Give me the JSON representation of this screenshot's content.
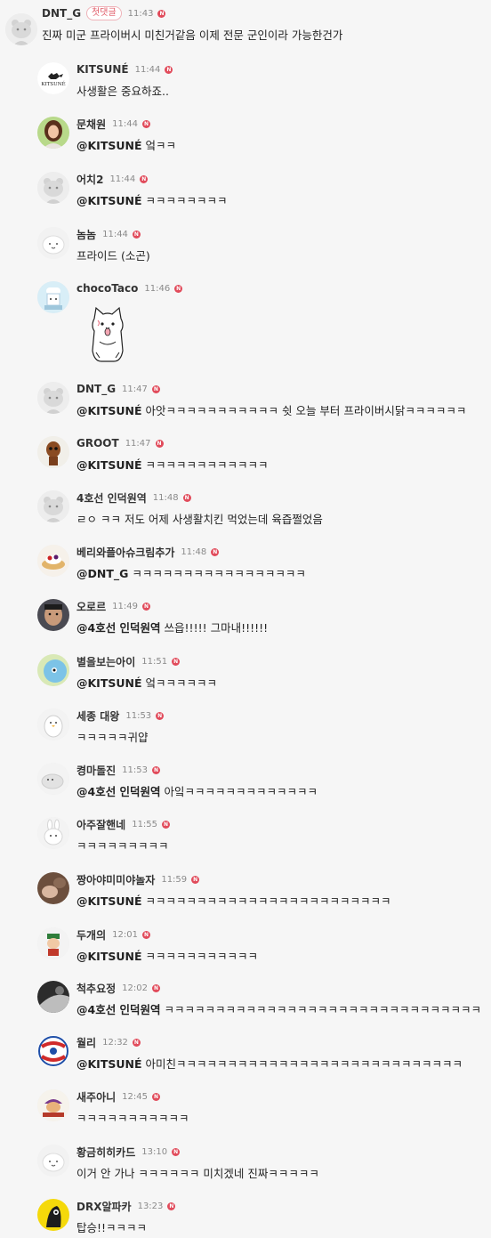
{
  "comments": [
    {
      "author": "DNT_G",
      "badge": "첫댓글",
      "time": "11:43",
      "new_mark": "N",
      "mention": "",
      "text": "진짜 미군 프라이버시 미친거같음 이제 전문 군인이라 가능한건가",
      "avatar_icon": "gray-bear-avatar"
    },
    {
      "author": "KITSUNÉ",
      "time": "11:44",
      "new_mark": "N",
      "mention": "",
      "text": "사생활은 중요하죠..",
      "avatar_icon": "kitsune-fox-logo-avatar",
      "avatar_logo_text": "KITSUNÉ"
    },
    {
      "author": "문채원",
      "time": "11:44",
      "new_mark": "N",
      "mention": "@KITSUNÉ",
      "text": "엌ㅋㅋ",
      "avatar_icon": "woman-photo-avatar"
    },
    {
      "author": "어치2",
      "time": "11:44",
      "new_mark": "N",
      "mention": "@KITSUNÉ",
      "text": "ㅋㅋㅋㅋㅋㅋㅋㅋ",
      "avatar_icon": "gray-bear-avatar"
    },
    {
      "author": "놈놈",
      "time": "11:44",
      "new_mark": "N",
      "mention": "",
      "text": "프라이드 (소곤)",
      "avatar_icon": "white-bunny-avatar"
    },
    {
      "author": "chocoTaco",
      "time": "11:46",
      "new_mark": "N",
      "mention": "",
      "text": "",
      "avatar_icon": "chef-character-avatar",
      "sticker": "cat-sticker"
    },
    {
      "author": "DNT_G",
      "time": "11:47",
      "new_mark": "N",
      "mention": "@KITSUNÉ",
      "text": "아앗ㅋㅋㅋㅋㅋㅋㅋㅋㅋㅋㅋ 쉿 오늘 부터 프라이버시닭ㅋㅋㅋㅋㅋㅋ",
      "avatar_icon": "gray-bear-avatar"
    },
    {
      "author": "GROOT",
      "time": "11:47",
      "new_mark": "N",
      "mention": "@KITSUNÉ",
      "text": "ㅋㅋㅋㅋㅋㅋㅋㅋㅋㅋㅋㅋ",
      "avatar_icon": "groot-avatar"
    },
    {
      "author": "4호선 인덕원역",
      "time": "11:48",
      "new_mark": "N",
      "mention": "",
      "text": "ㄹㅇ ㅋㅋ 저도 어제 사생활치킨 먹었는데 육즙쩔었음",
      "avatar_icon": "gray-bear-avatar"
    },
    {
      "author": "베리와플아슈크림추가",
      "time": "11:48",
      "new_mark": "N",
      "mention": "@DNT_G",
      "text": "ㅋㅋㅋㅋㅋㅋㅋㅋㅋㅋㅋㅋㅋㅋㅋㅋㅋ",
      "avatar_icon": "waffle-avatar"
    },
    {
      "author": "오로르",
      "time": "11:49",
      "new_mark": "N",
      "mention": "@4호선 인덕원역",
      "text": "쓰읍!!!!! 그마내!!!!!!",
      "avatar_icon": "man-photo-avatar"
    },
    {
      "author": "별을보는아이",
      "time": "11:51",
      "new_mark": "N",
      "mention": "@KITSUNÉ",
      "text": "엌ㅋㅋㅋㅋㅋㅋ",
      "avatar_icon": "bird-avatar"
    },
    {
      "author": "세종 대왕",
      "time": "11:53",
      "new_mark": "N",
      "mention": "",
      "text": "ㅋㅋㅋㅋㅋ귀얍",
      "avatar_icon": "penguin-avatar"
    },
    {
      "author": "켱마돌진",
      "time": "11:53",
      "new_mark": "N",
      "mention": "@4호선 인덕원역",
      "text": "아잌ㅋㅋㅋㅋㅋㅋㅋㅋㅋㅋㅋㅋㅋ",
      "avatar_icon": "seal-avatar"
    },
    {
      "author": "아주잘핸네",
      "time": "11:55",
      "new_mark": "N",
      "mention": "",
      "text": "ㅋㅋㅋㅋㅋㅋㅋㅋㅋ",
      "avatar_icon": "rabbit-avatar"
    },
    {
      "author": "짱아야미미야놀자",
      "time": "11:59",
      "new_mark": "N",
      "mention": "@KITSUNÉ",
      "text": "ㅋㅋㅋㅋㅋㅋㅋㅋㅋㅋㅋㅋㅋㅋㅋㅋㅋㅋㅋㅋㅋㅋㅋㅋ",
      "avatar_icon": "photo-avatar"
    },
    {
      "author": "두개의",
      "time": "12:01",
      "new_mark": "N",
      "mention": "@KITSUNÉ",
      "text": "ㅋㅋㅋㅋㅋㅋㅋㅋㅋㅋㅋ",
      "avatar_icon": "character-avatar"
    },
    {
      "author": "척추요정",
      "time": "12:02",
      "new_mark": "N",
      "mention": "@4호선 인덕원역",
      "text": "ㅋㅋㅋㅋㅋㅋㅋㅋㅋㅋㅋㅋㅋㅋㅋㅋㅋㅋㅋㅋㅋㅋㅋㅋㅋㅋㅋㅋㅋㅋㅋ",
      "avatar_icon": "bw-photo-avatar"
    },
    {
      "author": "월리",
      "time": "12:32",
      "new_mark": "N",
      "mention": "@KITSUNÉ",
      "text": "아미친ㅋㅋㅋㅋㅋㅋㅋㅋㅋㅋㅋㅋㅋㅋㅋㅋㅋㅋㅋㅋㅋㅋㅋㅋㅋㅋㅋㅋ",
      "avatar_icon": "wally-logo-avatar"
    },
    {
      "author": "새주아니",
      "time": "12:45",
      "new_mark": "N",
      "mention": "",
      "text": "ㅋㅋㅋㅋㅋㅋㅋㅋㅋㅋㅋ",
      "avatar_icon": "cartoon-avatar"
    },
    {
      "author": "황금히히카드",
      "time": "13:10",
      "new_mark": "N",
      "mention": "",
      "text": "이거 안 가나 ㅋㅋㅋㅋㅋㅋ 미치겠네 진짜ㅋㅋㅋㅋㅋ",
      "avatar_icon": "white-bunny-avatar"
    },
    {
      "author": "DRX알파카",
      "time": "13:23",
      "new_mark": "N",
      "mention": "",
      "text": "탑승!!ㅋㅋㅋㅋ",
      "avatar_icon": "drx-logo-avatar"
    }
  ]
}
